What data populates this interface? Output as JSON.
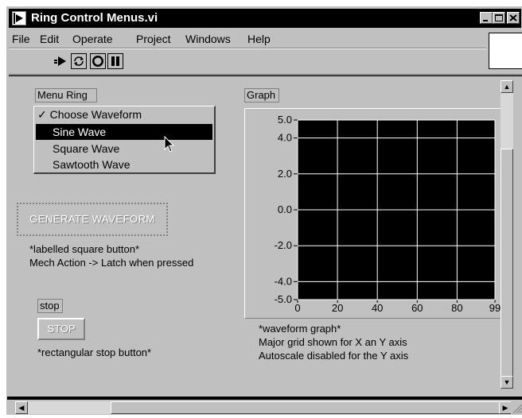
{
  "window": {
    "title": "Ring Control Menus.vi"
  },
  "menubar": {
    "items": [
      {
        "label": "File"
      },
      {
        "label": "Edit"
      },
      {
        "label": "Operate"
      },
      {
        "label": "Project"
      },
      {
        "label": "Windows"
      },
      {
        "label": "Help"
      }
    ]
  },
  "toolbar": {
    "icons": [
      "run-icon",
      "run-continuously-icon",
      "abort-icon",
      "pause-icon"
    ]
  },
  "menu_ring": {
    "label": "Menu Ring",
    "items": [
      "✓ Choose Waveform",
      "Sine Wave",
      "Square Wave",
      "Sawtooth Wave"
    ],
    "highlighted": "Sine Wave"
  },
  "generate_button": {
    "label": "GENERATE WAVEFORM",
    "note_line1": "*labelled square button*",
    "note_line2": "Mech Action -> Latch when pressed"
  },
  "stop": {
    "label": "stop",
    "button_text": "STOP",
    "note": "*rectangular stop button*"
  },
  "graph": {
    "label": "Graph",
    "note_line1": "*waveform graph*",
    "note_line2": "Major grid shown for X an Y axis",
    "note_line3": "Autoscale disabled for the Y axis",
    "plot_bg": "#000000",
    "grid_color": "#ffffff"
  },
  "chart_data": {
    "type": "line",
    "series": [],
    "x_ticks": [
      "0",
      "20",
      "40",
      "60",
      "80",
      "99"
    ],
    "y_ticks": [
      "5.0",
      "4.0",
      "2.0",
      "0.0",
      "-2.0",
      "-4.0",
      "-5.0"
    ],
    "xlim": [
      0,
      99
    ],
    "ylim": [
      -5,
      5
    ],
    "grid": true
  }
}
